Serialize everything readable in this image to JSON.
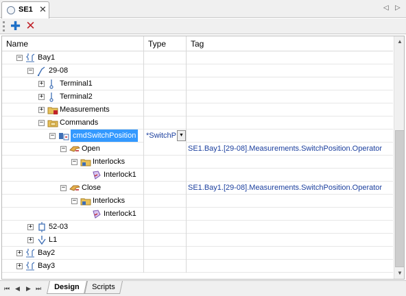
{
  "tab": {
    "title": "SE1",
    "close": "✕",
    "nav_prev": "◁",
    "nav_next": "▷"
  },
  "toolbar": {
    "add": "✚",
    "delete": "✕"
  },
  "columns": {
    "name": "Name",
    "type": "Type",
    "tag": "Tag"
  },
  "rows": [
    {
      "level": 0,
      "expander": "minus",
      "icon": "bay-icon",
      "label": "Bay1",
      "type": "",
      "tag": ""
    },
    {
      "level": 1,
      "expander": "minus",
      "icon": "switch-icon",
      "label": "29-08",
      "type": "",
      "tag": ""
    },
    {
      "level": 2,
      "expander": "plus",
      "icon": "terminal-icon",
      "label": "Terminal1",
      "type": "",
      "tag": ""
    },
    {
      "level": 2,
      "expander": "plus",
      "icon": "terminal-icon",
      "label": "Terminal2",
      "type": "",
      "tag": ""
    },
    {
      "level": 2,
      "expander": "plus",
      "icon": "measurements-folder-icon",
      "label": "Measurements",
      "type": "",
      "tag": ""
    },
    {
      "level": 2,
      "expander": "minus",
      "icon": "commands-folder-icon",
      "label": "Commands",
      "type": "",
      "tag": ""
    },
    {
      "level": 3,
      "expander": "minus",
      "icon": "command-icon",
      "label": "cmdSwitchPosition",
      "type": "*SwitchP",
      "tag": "",
      "selected": true
    },
    {
      "level": 4,
      "expander": "minus",
      "icon": "hand-icon",
      "label": "Open",
      "type": "",
      "tag": "SE1.Bay1.[29-08].Measurements.SwitchPosition.Operator"
    },
    {
      "level": 5,
      "expander": "minus",
      "icon": "interlocks-folder-icon",
      "label": "Interlocks",
      "type": "",
      "tag": ""
    },
    {
      "level": 6,
      "expander": "",
      "icon": "interlock-icon",
      "label": "Interlock1",
      "type": "",
      "tag": ""
    },
    {
      "level": 4,
      "expander": "minus",
      "icon": "hand-icon",
      "label": "Close",
      "type": "",
      "tag": "SE1.Bay1.[29-08].Measurements.SwitchPosition.Operator"
    },
    {
      "level": 5,
      "expander": "minus",
      "icon": "interlocks-folder-icon",
      "label": "Interlocks",
      "type": "",
      "tag": ""
    },
    {
      "level": 6,
      "expander": "",
      "icon": "interlock-icon",
      "label": "Interlock1",
      "type": "",
      "tag": ""
    },
    {
      "level": 1,
      "expander": "plus",
      "icon": "breaker-icon",
      "label": "52-03",
      "type": "",
      "tag": ""
    },
    {
      "level": 1,
      "expander": "plus",
      "icon": "load-icon",
      "label": "L1",
      "type": "",
      "tag": ""
    },
    {
      "level": 0,
      "expander": "plus",
      "icon": "bay-icon",
      "label": "Bay2",
      "type": "",
      "tag": ""
    },
    {
      "level": 0,
      "expander": "plus",
      "icon": "bay-icon",
      "label": "Bay3",
      "type": "",
      "tag": ""
    }
  ],
  "scrollbar": {
    "position": 0.62
  },
  "bottom": {
    "first": "⏮",
    "prev": "◀",
    "next": "▶",
    "last": "⏭",
    "tabs": [
      "Design",
      "Scripts"
    ]
  },
  "colors": {
    "selection": "#3399ff",
    "tag_text": "#1b3f9e"
  }
}
